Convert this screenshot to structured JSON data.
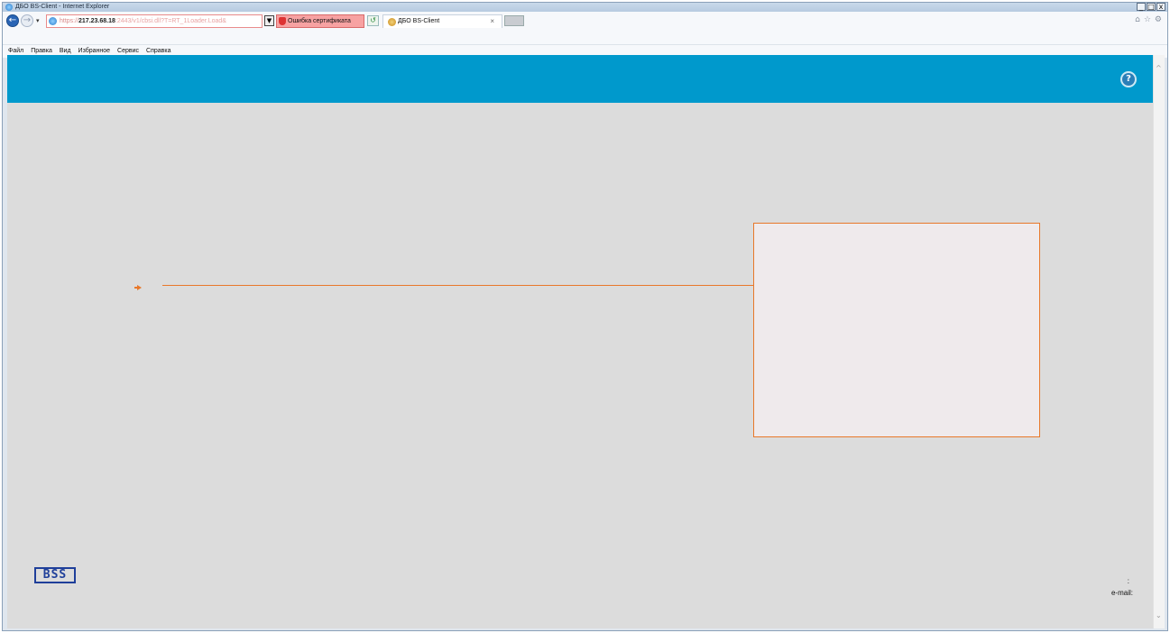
{
  "window": {
    "title": "ДБО BS-Client - Internet Explorer",
    "controls": [
      "_",
      "□",
      "x"
    ]
  },
  "address_bar": {
    "url_prefix": "https://",
    "url_host": "217.23.68.18",
    "url_rest": ":2443/v1/cbsi.dll?T=RT_1Loader.Load&",
    "cert_error": "Ошибка сертификата"
  },
  "tab": {
    "label": "ДБО BS-Client",
    "close": "×"
  },
  "menu": [
    "Файл",
    "Правка",
    "Вид",
    "Избранное",
    "Сервис",
    "Справка"
  ],
  "page": {
    "help": "?",
    "logo": "BSS",
    "footer_colon": ":",
    "footer_email": "e-mail:"
  },
  "colors": {
    "header": "#0099cc",
    "accent": "#e8782a",
    "background": "#dcdcdc",
    "panel": "#efeaec",
    "logo": "#1f3f9a"
  }
}
